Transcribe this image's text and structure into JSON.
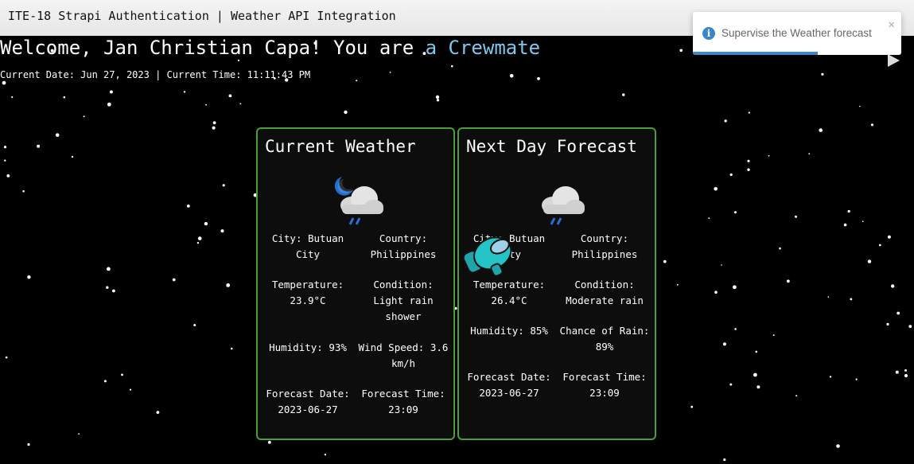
{
  "window": {
    "title": "ITE-18 Strapi Authentication | Weather API Integration"
  },
  "welcome": {
    "prefix": "Welcome, Jan Christian Capa! You are ",
    "role": "a Crewmate"
  },
  "datetime": "Current Date: Jun 27, 2023 | Current Time: 11:11:43 PM",
  "current": {
    "title": "Current Weather",
    "icon": "night-rain-cloud-icon",
    "city": "City: Butuan City",
    "country": "Country: Philippines",
    "temperature": "Temperature: 23.9°C",
    "condition": "Condition: Light rain shower",
    "humidity": "Humidity: 93%",
    "wind": "Wind Speed: 3.6 km/h",
    "forecast_date": "Forecast Date: 2023-06-27",
    "forecast_time": "Forecast Time: 23:09"
  },
  "next": {
    "title": "Next Day Forecast",
    "icon": "rain-cloud-icon",
    "city": "City: Butuan City",
    "country": "Country: Philippines",
    "temperature": "Temperature: 26.4°C",
    "condition": "Condition: Moderate rain",
    "humidity": "Humidity: 85%",
    "rain_chance": "Chance of Rain: 89%",
    "forecast_date": "Forecast Date: 2023-06-27",
    "forecast_time": "Forecast Time: 23:09"
  },
  "toast": {
    "message": "Supervise the Weather forecast",
    "close": "×",
    "info": "i",
    "progress": 0.6
  },
  "colors": {
    "accent": "#7ec8ee",
    "border": "#4a9e3a",
    "toast_bar": "#3a8acb"
  }
}
